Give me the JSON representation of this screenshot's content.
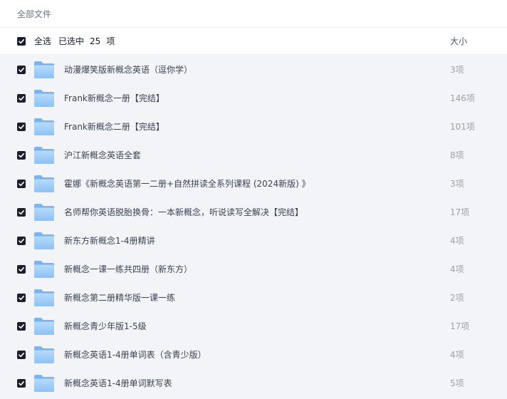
{
  "breadcrumb": {
    "root": "全部文件"
  },
  "header": {
    "select_all": "全选",
    "selected_prefix": "已选中",
    "selected_count": "25",
    "selected_suffix": "项",
    "size_column": "大小"
  },
  "colors": {
    "checkbox": "#1a1f2e",
    "folder_light": "#9ccaf7",
    "folder_dark": "#6aa9ee"
  },
  "files": [
    {
      "name": "动漫爆笑版新概念英语（逗你学）",
      "size": "3项",
      "type": "folder",
      "selected": true
    },
    {
      "name": "Frank新概念一册【完结】",
      "size": "146项",
      "type": "folder",
      "selected": true
    },
    {
      "name": "Frank新概念二册【完结】",
      "size": "101项",
      "type": "folder",
      "selected": true
    },
    {
      "name": "沪江新概念英语全套",
      "size": "8项",
      "type": "folder",
      "selected": true
    },
    {
      "name": "霍娜《新概念英语第一二册+自然拼读全系列课程 (2024新版) 》",
      "size": "3项",
      "type": "folder",
      "selected": true
    },
    {
      "name": "名师帮你英语脱胎换骨：一本新概念，听说读写全解决【完结】",
      "size": "17项",
      "type": "folder",
      "selected": true
    },
    {
      "name": "新东方新概念1-4册精讲",
      "size": "4项",
      "type": "folder",
      "selected": true
    },
    {
      "name": "新概念一课一练共四册（新东方）",
      "size": "4项",
      "type": "folder",
      "selected": true
    },
    {
      "name": "新概念第二册精华版一课一练",
      "size": "2项",
      "type": "folder",
      "selected": true
    },
    {
      "name": "新概念青少年版1-5级",
      "size": "17项",
      "type": "folder",
      "selected": true
    },
    {
      "name": "新概念英语1-4册单词表（含青少版）",
      "size": "4项",
      "type": "folder",
      "selected": true
    },
    {
      "name": "新概念英语1-4册单词默写表",
      "size": "5项",
      "type": "folder",
      "selected": true
    }
  ]
}
